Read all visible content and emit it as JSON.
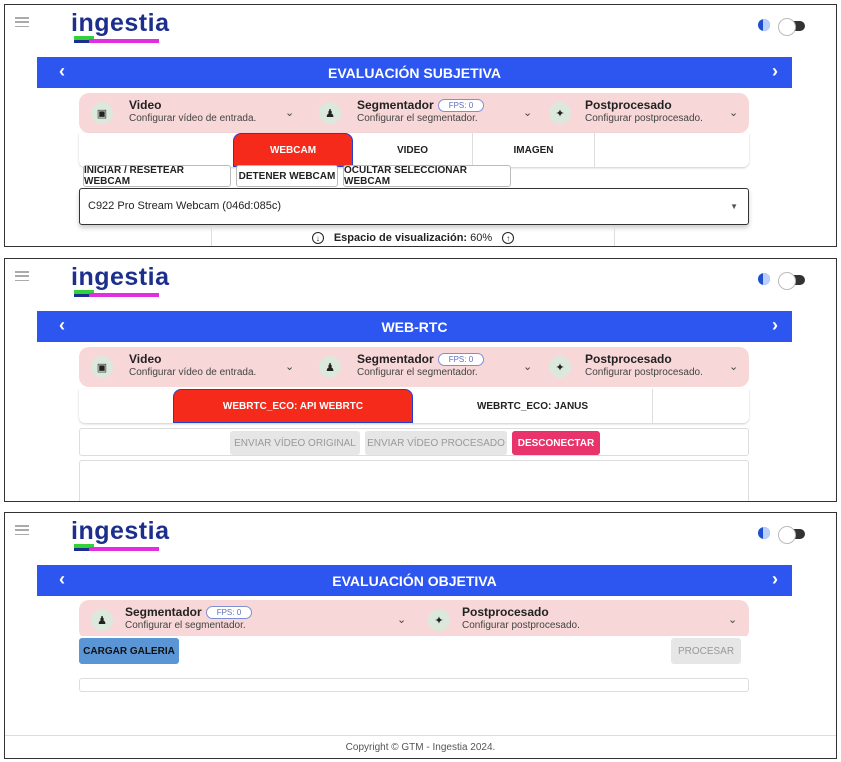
{
  "app": {
    "logo": "ingestia"
  },
  "colors": {
    "primary": "#2d55f0",
    "tab_active": "#f52a1a",
    "accordion_bg": "#f7d7d7",
    "disconnect": "#e8336b",
    "load_gallery": "#5a95d6"
  },
  "panels": [
    {
      "title": "EVALUACIÓN SUBJETIVA",
      "accordion": [
        {
          "icon": "video-input-icon",
          "title": "Video",
          "subtitle": "Configurar vídeo de entrada."
        },
        {
          "icon": "segmenter-icon",
          "title": "Segmentador",
          "fps": "FPS: 0",
          "subtitle": "Configurar el segmentador."
        },
        {
          "icon": "magic-wand-icon",
          "title": "Postprocesado",
          "subtitle": "Configurar postprocesado."
        }
      ],
      "tabs": [
        "WEBCAM",
        "VIDEO",
        "IMAGEN"
      ],
      "active_tab": "WEBCAM",
      "buttons": [
        "INICIAR / RESETEAR WEBCAM",
        "DETENER WEBCAM",
        "OCULTAR SELECCIONAR WEBCAM"
      ],
      "webcam_select": {
        "value": "C922 Pro Stream Webcam (046d:085c)"
      },
      "viewport": {
        "label": "Espacio de visualización:",
        "value": "60%"
      }
    },
    {
      "title": "WEB-RTC",
      "accordion": [
        {
          "icon": "video-input-icon",
          "title": "Video",
          "subtitle": "Configurar vídeo de entrada."
        },
        {
          "icon": "segmenter-icon",
          "title": "Segmentador",
          "fps": "FPS: 0",
          "subtitle": "Configurar el segmentador."
        },
        {
          "icon": "magic-wand-icon",
          "title": "Postprocesado",
          "subtitle": "Configurar postprocesado."
        }
      ],
      "tabs": [
        "WEBRTC_ECO: API WEBRTC",
        "WEBRTC_ECO: JANUS"
      ],
      "active_tab": "WEBRTC_ECO: API WEBRTC",
      "buttons": [
        "ENVIAR VÍDEO ORIGINAL",
        "ENVIAR VÍDEO PROCESADO",
        "DESCONECTAR"
      ]
    },
    {
      "title": "EVALUACIÓN OBJETIVA",
      "accordion": [
        {
          "icon": "segmenter-icon",
          "title": "Segmentador",
          "fps": "FPS: 0",
          "subtitle": "Configurar el segmentador."
        },
        {
          "icon": "magic-wand-icon",
          "title": "Postprocesado",
          "subtitle": "Configurar postprocesado."
        }
      ],
      "buttons": [
        "CARGAR GALERIA",
        "PROCESAR"
      ],
      "footer": "Copyright © GTM - Ingestia 2024."
    }
  ]
}
